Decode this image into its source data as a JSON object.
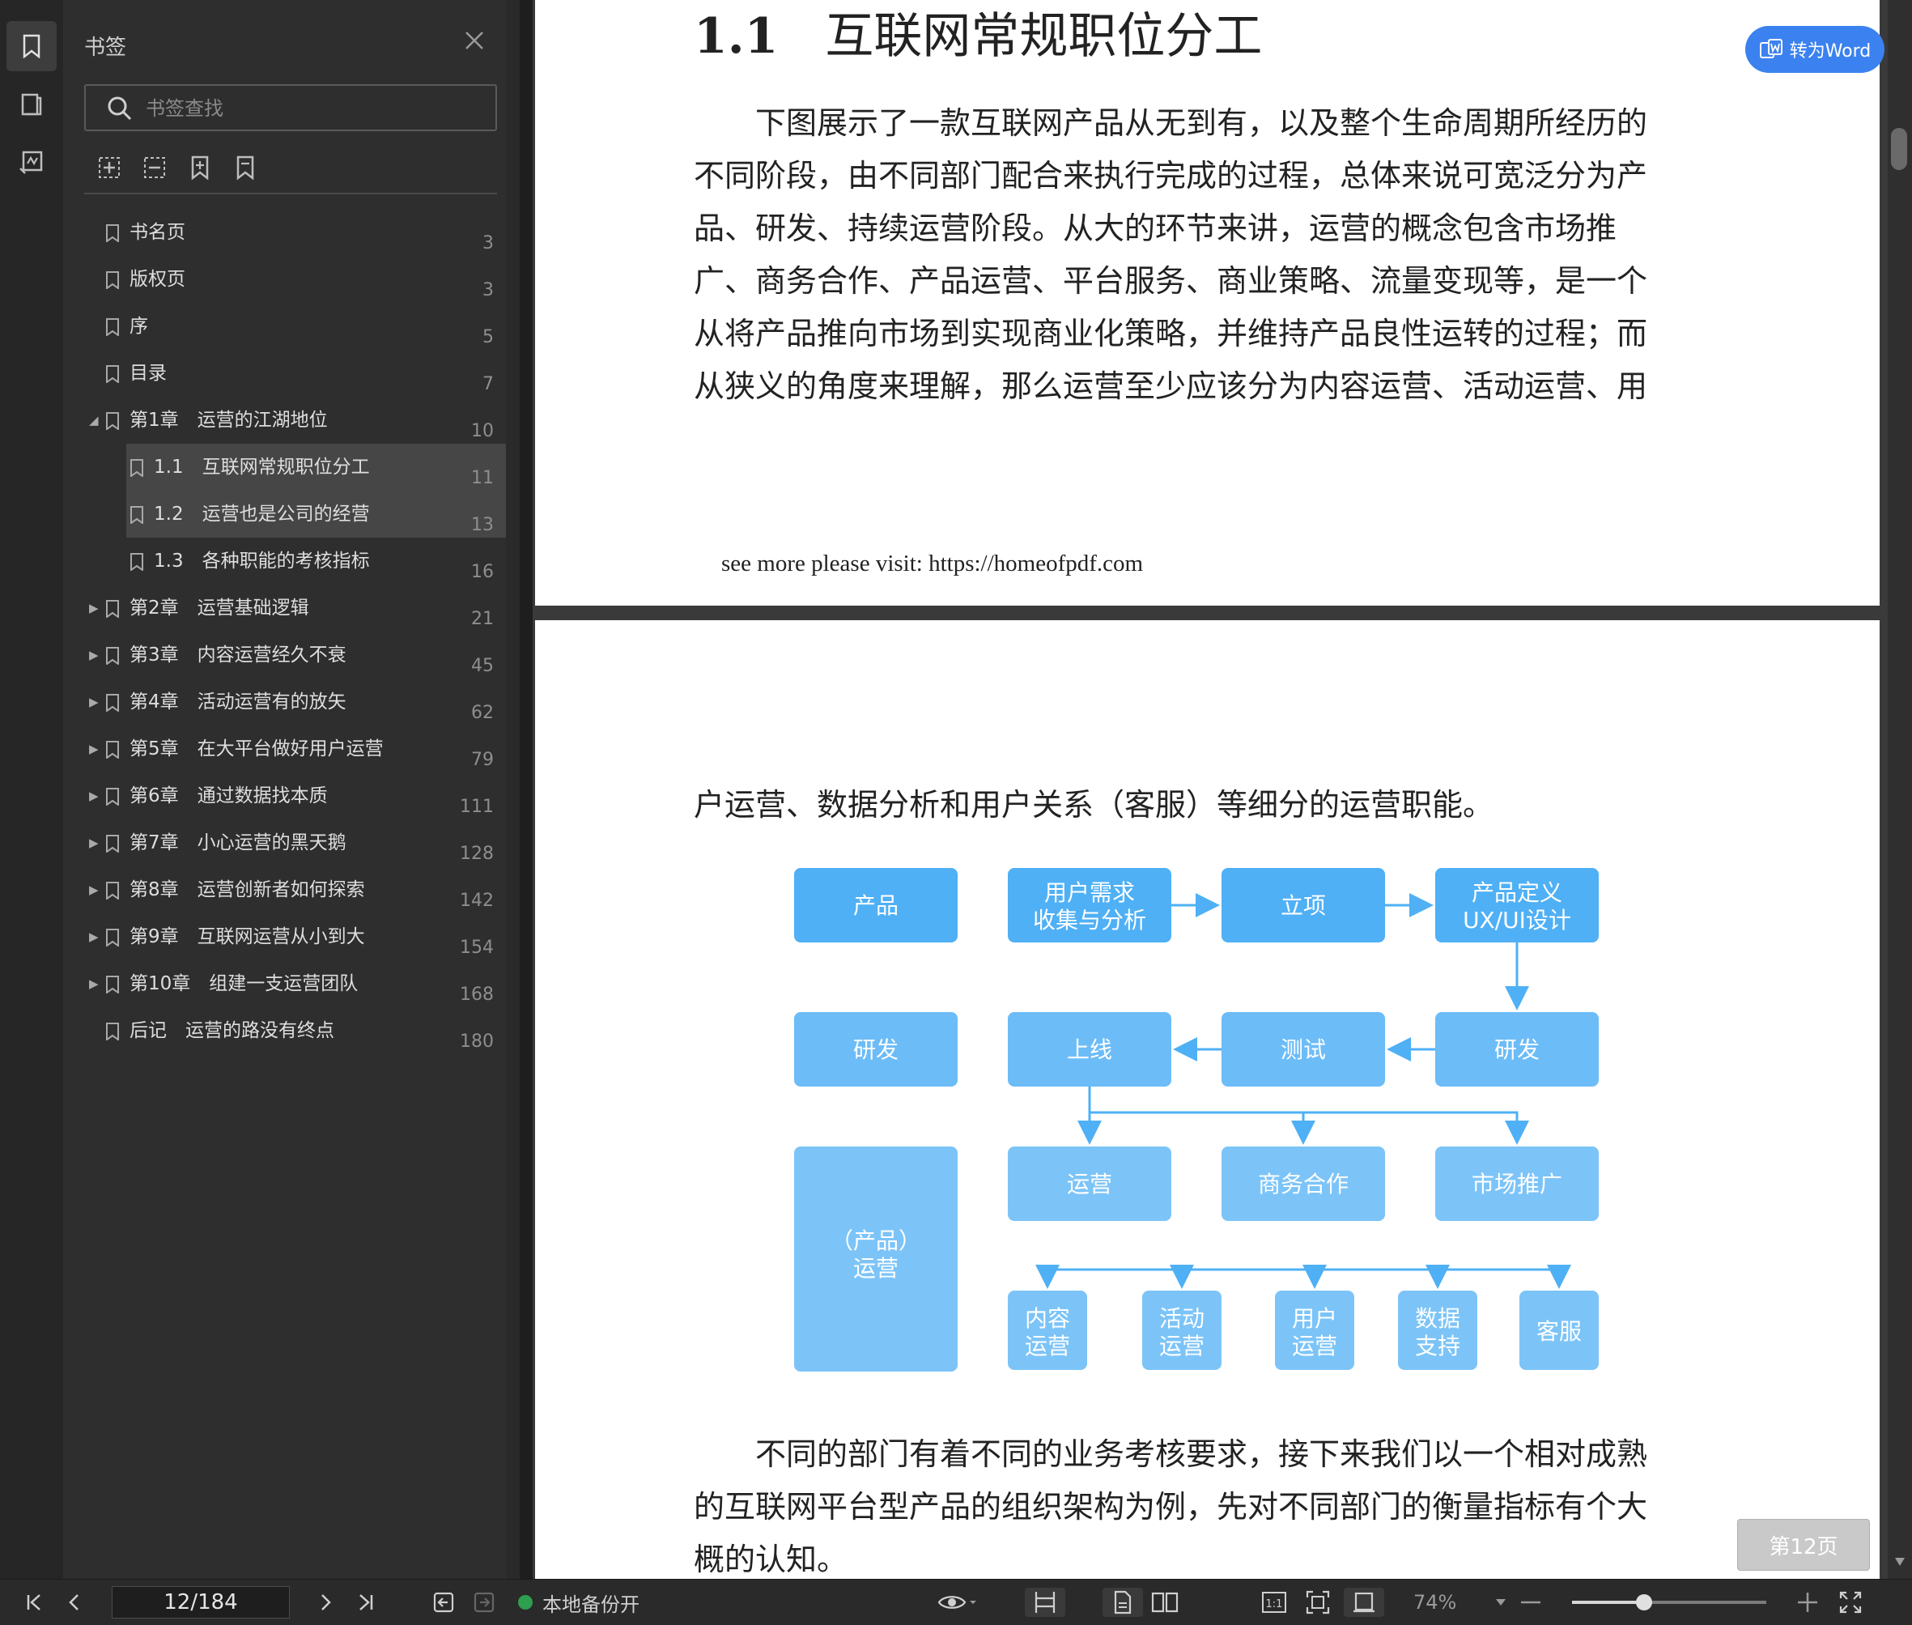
{
  "sidebar": {
    "title": "书签",
    "search_placeholder": "书签查找",
    "tools": [
      "expand-all-icon",
      "collapse-all-icon",
      "add-bookmark-icon",
      "bookmark-outline-icon"
    ],
    "items": [
      {
        "label": "书名页",
        "page": "3",
        "level": 0,
        "toggle": ""
      },
      {
        "label": "版权页",
        "page": "3",
        "level": 0,
        "toggle": ""
      },
      {
        "label": "序",
        "page": "5",
        "level": 0,
        "toggle": ""
      },
      {
        "label": "目录",
        "page": "7",
        "level": 0,
        "toggle": ""
      },
      {
        "label": "第1章　运营的江湖地位",
        "page": "10",
        "level": 0,
        "toggle": "◢"
      },
      {
        "label": "1.1　互联网常规职位分工",
        "page": "11",
        "level": 1,
        "toggle": "",
        "selected": true
      },
      {
        "label": "1.2　运营也是公司的经营",
        "page": "13",
        "level": 1,
        "toggle": "",
        "selected": true
      },
      {
        "label": "1.3　各种职能的考核指标",
        "page": "16",
        "level": 1,
        "toggle": ""
      },
      {
        "label": "第2章　运营基础逻辑",
        "page": "21",
        "level": 0,
        "toggle": "▶"
      },
      {
        "label": "第3章　内容运营经久不衰",
        "page": "45",
        "level": 0,
        "toggle": "▶"
      },
      {
        "label": "第4章　活动运营有的放矢",
        "page": "62",
        "level": 0,
        "toggle": "▶"
      },
      {
        "label": "第5章　在大平台做好用户运营",
        "page": "79",
        "level": 0,
        "toggle": "▶"
      },
      {
        "label": "第6章　通过数据找本质",
        "page": "111",
        "level": 0,
        "toggle": "▶"
      },
      {
        "label": "第7章　小心运营的黑天鹅",
        "page": "128",
        "level": 0,
        "toggle": "▶"
      },
      {
        "label": "第8章　运营创新者如何探索",
        "page": "142",
        "level": 0,
        "toggle": "▶"
      },
      {
        "label": "第9章　互联网运营从小到大",
        "page": "154",
        "level": 0,
        "toggle": "▶"
      },
      {
        "label": "第10章　组建一支运营团队",
        "page": "168",
        "level": 0,
        "toggle": "▶"
      },
      {
        "label": "后记　运营的路没有终点",
        "page": "180",
        "level": 0,
        "toggle": ""
      }
    ]
  },
  "doc": {
    "heading_num": "1.1",
    "heading_text": "互联网常规职位分工",
    "para1_lines": [
      "　　下图展示了一款互联网产品从无到有，以及整个生命周期所经历的",
      "不同阶段，由不同部门配合来执行完成的过程，总体来说可宽泛分为产",
      "品、研发、持续运营阶段。从大的环节来讲，运营的概念包含市场推",
      "广、商务合作、产品运营、平台服务、商业策略、流量变现等，是一个",
      "从将产品推向市场到实现商业化策略，并维持产品良性运转的过程；而",
      "从狭义的角度来理解，那么运营至少应该分为内容运营、活动运营、用"
    ],
    "footer_note": "see more please visit: https://homeofpdf.com",
    "para2": "户运营、数据分析和用户关系（客服）等细分的运营职能。",
    "para3_lines": [
      "　　不同的部门有着不同的业务考核要求，接下来我们以一个相对成熟",
      "的互联网平台型产品的组织架构为例，先对不同部门的衡量指标有个大",
      "概的认知。"
    ],
    "diagram": {
      "stage_product": "产品",
      "stage_dev": "研发",
      "stage_ops": [
        "（产品）",
        "运营"
      ],
      "demand": [
        "用户需求",
        "收集与分析"
      ],
      "project": "立项",
      "definition": [
        "产品定义",
        "UX/UI设计"
      ],
      "launch": "上线",
      "test": "测试",
      "develop": "研发",
      "operation": "运营",
      "business": "商务合作",
      "marketing": "市场推广",
      "content_ops": [
        "内容",
        "运营"
      ],
      "activity_ops": [
        "活动",
        "运营"
      ],
      "user_ops": [
        "用户",
        "运营"
      ],
      "data_support": [
        "数据",
        "支持"
      ],
      "customer_service": "客服",
      "colors": {
        "dark": "#4fb0f5",
        "light": "#7cc4f8"
      }
    }
  },
  "convert_button": "转为Word",
  "page_badge": "第12页",
  "status": {
    "page_indicator": "12/184",
    "backup_text": "本地备份开",
    "zoom": "74%",
    "zoom_fraction": 0.37
  }
}
